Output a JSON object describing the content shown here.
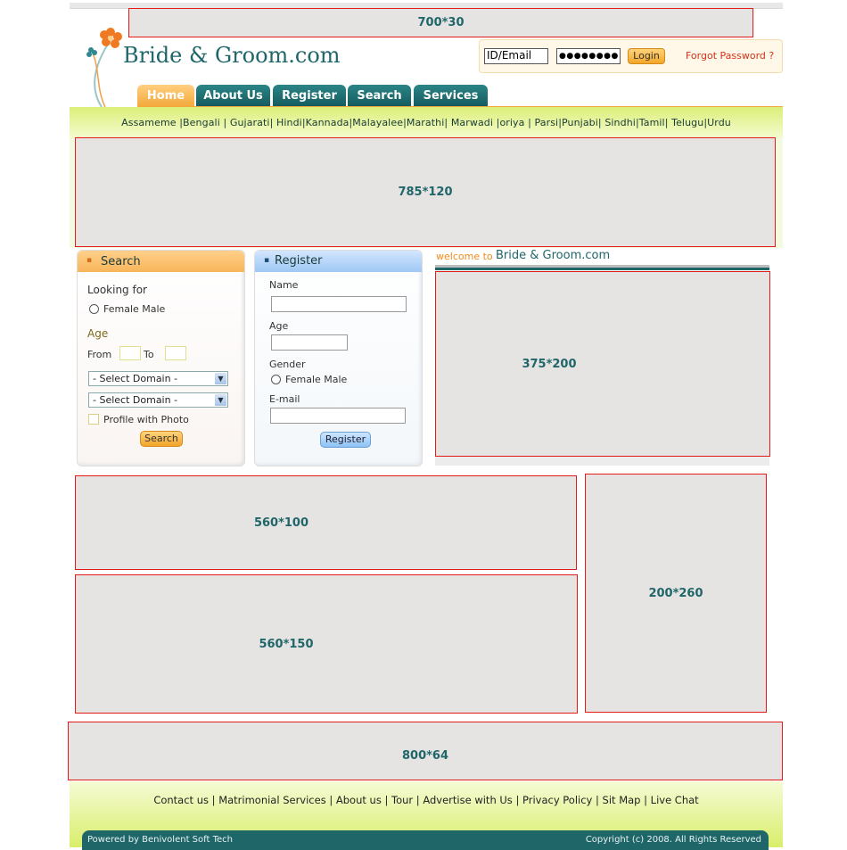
{
  "header": {
    "top_ad": "700*30",
    "logo_text": "Bride & Groom.com",
    "login": {
      "id_value": "ID/Email",
      "password_value": "●●●●●●●●",
      "button": "Login",
      "forgot": "Forgot Password ?"
    }
  },
  "nav": {
    "tabs": [
      "Home",
      "About Us",
      "Register",
      "Search",
      "Services"
    ]
  },
  "languages": "Assameme |Bengali | Gujarati| Hindi|Kannada|Malayalee|Marathi| Marwadi |oriya | Parsi|Punjabi| Sindhi|Tamil| Telugu|Urdu",
  "banner": "785*120",
  "search_panel": {
    "title": "Search",
    "looking_for": "Looking for",
    "gender_option": "Female Male",
    "age": "Age",
    "from": "From",
    "to": "To",
    "domain1": "- Select Domain -",
    "domain2": "- Select Domain -",
    "photo": "Profile with Photo",
    "button": "Search"
  },
  "register_panel": {
    "title": "Register",
    "name": "Name",
    "age": "Age",
    "gender": "Gender",
    "gender_option": "Female Male",
    "email": "E-mail",
    "button": "Register"
  },
  "welcome": {
    "prefix": "welcome to",
    "site": "Bride & Groom.com",
    "ad": "375*200"
  },
  "ads": {
    "ad_560x100": "560*100",
    "ad_560x150": "560*150",
    "ad_200x260": "200*260",
    "ad_800x64": "800*64"
  },
  "footer": {
    "links": [
      "Contact us",
      "Matrimonial Services",
      "About us",
      "Tour",
      "Advertise with Us",
      "Privacy Policy",
      "Sit Map",
      "Live Chat"
    ],
    "powered": "Powered by Benivolent Soft Tech",
    "copyright": "Copyright (c) 2008. All Rights Reserved"
  },
  "colors": {
    "teal": "#1f6669",
    "orange": "#f3a83a",
    "lime": "#dcef7a",
    "placeholder": "#e6e3e3",
    "placeholder_border": "#e21b1b"
  }
}
